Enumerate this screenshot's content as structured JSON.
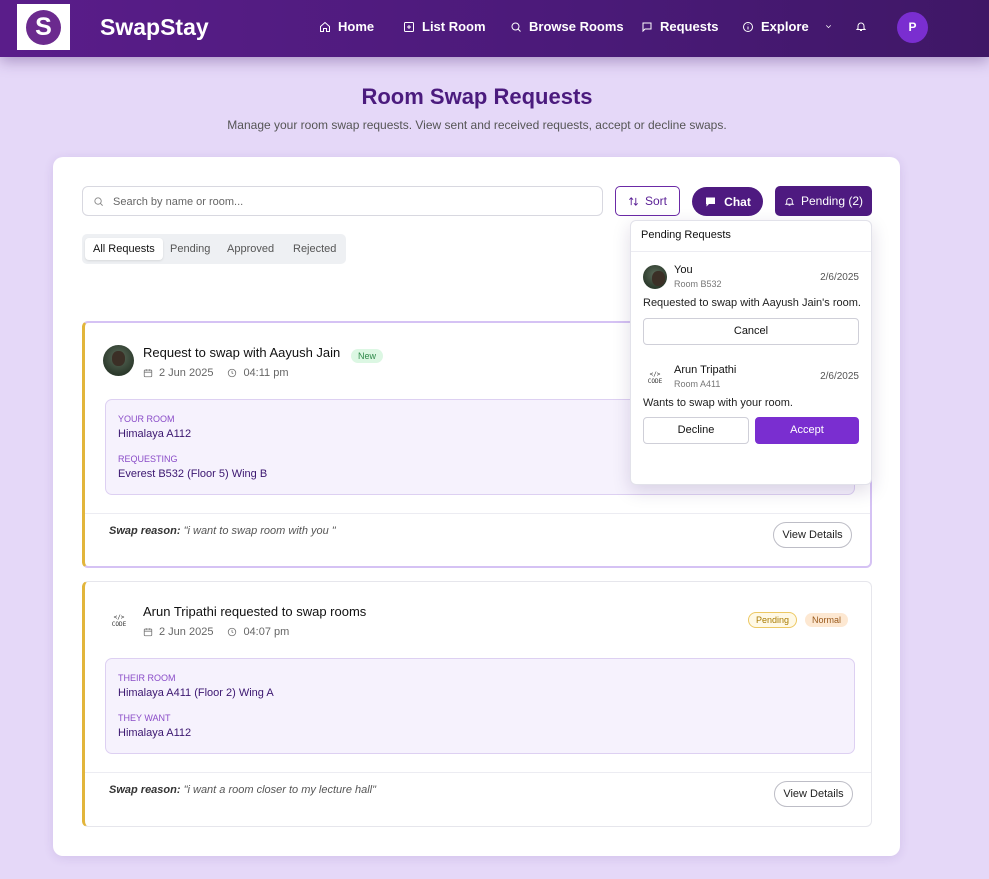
{
  "nav": {
    "logo_letter": "S",
    "brand": "SwapStay",
    "items": [
      {
        "label": "Home",
        "icon": "home-icon"
      },
      {
        "label": "List Room",
        "icon": "plus-square-icon"
      },
      {
        "label": "Browse Rooms",
        "icon": "search-icon"
      },
      {
        "label": "Requests",
        "icon": "message-icon"
      },
      {
        "label": "Explore",
        "icon": "info-icon"
      }
    ],
    "avatar_initial": "P"
  },
  "header": {
    "title": "Room Swap Requests",
    "subtitle": "Manage your room swap requests. View sent and received requests, accept or decline swaps."
  },
  "toolbar": {
    "search_placeholder": "Search by name or room...",
    "sort_label": "Sort",
    "chat_label": "Chat",
    "pending_label": "Pending (2)"
  },
  "tabs": [
    "All Requests",
    "Pending",
    "Approved",
    "Rejected"
  ],
  "requests": [
    {
      "title": "Request to swap with Aayush Jain",
      "badge": "New",
      "date": "2 Jun 2025",
      "time": "04:11 pm",
      "label1": "YOUR ROOM",
      "value1": "Himalaya A112",
      "label2": "REQUESTING",
      "value2": "Everest B532 (Floor 5) Wing B",
      "reason_label": "Swap reason:",
      "reason": "\"i want to swap room with you \"",
      "button": "View Details"
    },
    {
      "title": "Arun Tripathi requested to swap rooms",
      "badge_status": "Pending",
      "badge_priority": "Normal",
      "date": "2 Jun 2025",
      "time": "04:07 pm",
      "label1": "THEIR ROOM",
      "value1": "Himalaya A411 (Floor 2) Wing A",
      "label2": "THEY WANT",
      "value2": "Himalaya A112",
      "reason_label": "Swap reason:",
      "reason": "\"i want a room closer to my lecture hall\"",
      "button": "View Details"
    }
  ],
  "dropdown": {
    "title": "Pending Requests",
    "items": [
      {
        "name": "You",
        "room": "Room B532",
        "date": "2/6/2025",
        "message": "Requested to swap with Aayush Jain's room.",
        "button": "Cancel"
      },
      {
        "name": "Arun Tripathi",
        "room": "Room A411",
        "date": "2/6/2025",
        "message": "Wants to swap with your room.",
        "decline": "Decline",
        "accept": "Accept"
      }
    ]
  },
  "code_logo_text": "CODE",
  "colors": {
    "primary": "#4e1a80",
    "accent": "#7a2ed0",
    "background": "#e5d8f8",
    "card_border": "#e2b53b"
  }
}
